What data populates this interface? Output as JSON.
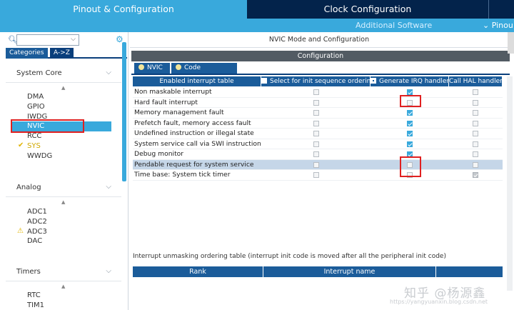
{
  "top_tabs": [
    {
      "label": "Pinout & Configuration"
    },
    {
      "label": "Clock Configuration"
    }
  ],
  "sub_bar": {
    "additional_software": "Additional Software",
    "pinout": "Pinou"
  },
  "left": {
    "cat_tabs": [
      "Categories",
      "A->Z"
    ],
    "sections": [
      {
        "title": "System Core",
        "items": [
          "DMA",
          "GPIO",
          "IWDG",
          "NVIC",
          "RCC",
          "SYS",
          "WWDG"
        ]
      },
      {
        "title": "Analog",
        "items": [
          "ADC1",
          "ADC2",
          "ADC3",
          "DAC"
        ]
      },
      {
        "title": "Timers",
        "items": [
          "RTC",
          "TIM1"
        ]
      }
    ]
  },
  "main": {
    "mode_title": "NVIC Mode and Configuration",
    "config_title": "Configuration",
    "tabs": [
      "NVIC",
      "Code generation"
    ],
    "columns": [
      "Enabled interrupt table",
      "Select for init sequence ordering",
      "Generate IRQ handler",
      "Call HAL handler"
    ],
    "rows": [
      {
        "name": "Non maskable interrupt",
        "select": "off",
        "irq": "on",
        "hal": "off"
      },
      {
        "name": "Hard fault interrupt",
        "select": "off",
        "irq": "off",
        "hal": "off"
      },
      {
        "name": "Memory management fault",
        "select": "off",
        "irq": "on",
        "hal": "off"
      },
      {
        "name": "Prefetch fault, memory access fault",
        "select": "off",
        "irq": "on",
        "hal": "off"
      },
      {
        "name": "Undefined instruction or illegal state",
        "select": "off",
        "irq": "on",
        "hal": "off"
      },
      {
        "name": "System service call via SWI instruction",
        "select": "off",
        "irq": "on",
        "hal": "off"
      },
      {
        "name": "Debug monitor",
        "select": "off",
        "irq": "on",
        "hal": "off"
      },
      {
        "name": "Pendable request for system service",
        "select": "off",
        "irq": "off",
        "hal": "off"
      },
      {
        "name": "Time base: System tick timer",
        "select": "off",
        "irq": "off",
        "hal": "grey"
      }
    ],
    "unmask_label": "Interrupt unmasking ordering table (interrupt init code is moved after all the peripheral init code)",
    "rank_columns": [
      "Rank",
      "Interrupt name"
    ]
  },
  "watermark": {
    "text": "知乎 @杨源鑫",
    "url": "https://yangyuanxin.blog.csdn.net"
  }
}
